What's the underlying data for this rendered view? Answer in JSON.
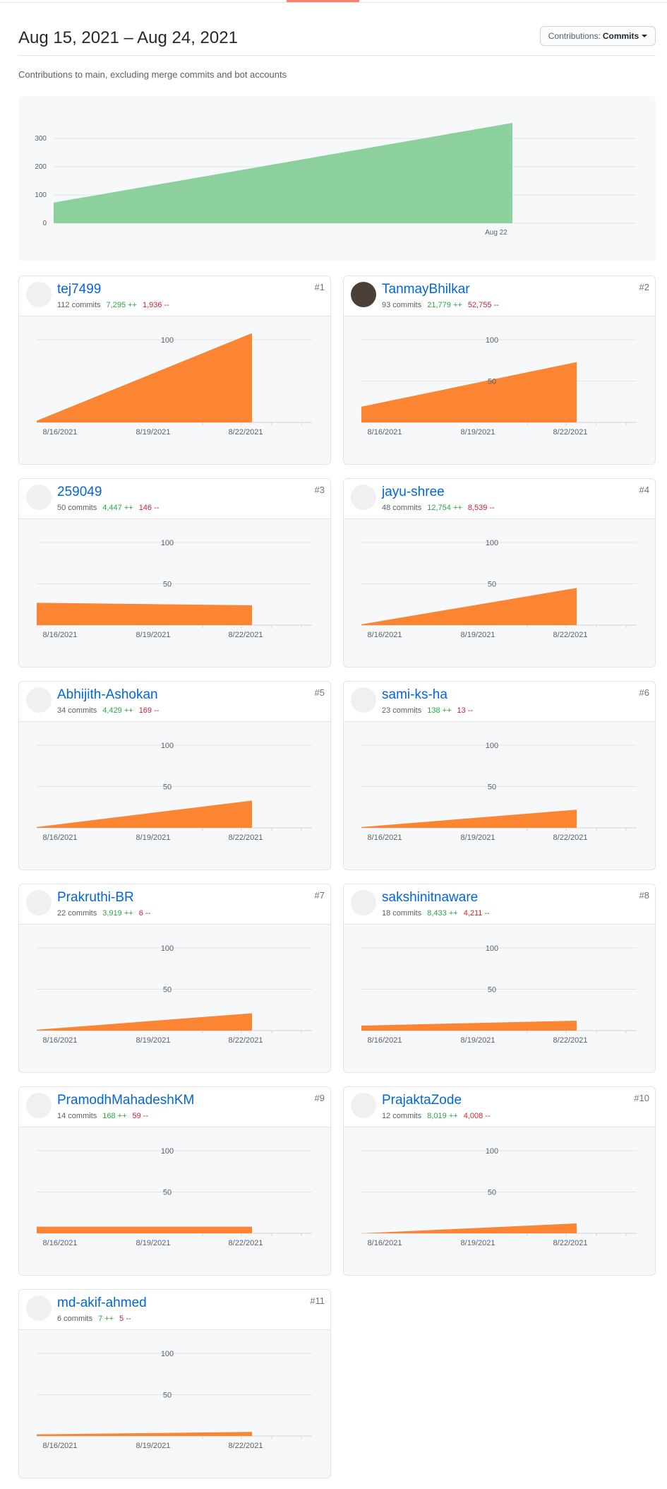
{
  "header": {
    "date_range": "Aug 15, 2021 – Aug 24, 2021",
    "select_prefix": "Contributions:",
    "select_value": "Commits",
    "subtitle": "Contributions to main, excluding merge commits and bot accounts"
  },
  "colors": {
    "total_fill": "#8cd19d",
    "contributor_fill": "#fb8532",
    "link": "#0366d6",
    "additions": "#28a745",
    "deletions": "#cb2431"
  },
  "chart_data": [
    {
      "type": "area",
      "series": [
        {
          "x": [
            "2021-08-15",
            "2021-08-24"
          ],
          "values": [
            73,
            355
          ]
        }
      ],
      "y_ticks": [
        0,
        100,
        200,
        300
      ],
      "x_ticks": [
        "Aug 22"
      ],
      "ylim": [
        0,
        380
      ],
      "grid": true
    },
    {
      "type": "area",
      "x_ticks": [
        "8/16/2021",
        "8/19/2021",
        "8/22/2021"
      ],
      "y_ticks": [
        100
      ],
      "ylim": [
        0,
        112
      ],
      "series": [
        {
          "x": [
            "8/15/2021",
            "8/22/2021"
          ],
          "values": [
            2,
            108
          ]
        }
      ]
    },
    {
      "type": "area",
      "x_ticks": [
        "8/16/2021",
        "8/19/2021",
        "8/22/2021"
      ],
      "y_ticks": [
        100,
        50
      ],
      "ylim": [
        0,
        112
      ],
      "series": [
        {
          "x": [
            "8/15/2021",
            "8/22/2021"
          ],
          "values": [
            19,
            73
          ]
        }
      ]
    },
    {
      "type": "area",
      "x_ticks": [
        "8/16/2021",
        "8/19/2021",
        "8/22/2021"
      ],
      "y_ticks": [
        100,
        50
      ],
      "ylim": [
        0,
        112
      ],
      "series": [
        {
          "x": [
            "8/15/2021",
            "8/22/2021"
          ],
          "values": [
            27,
            24
          ]
        }
      ]
    },
    {
      "type": "area",
      "x_ticks": [
        "8/16/2021",
        "8/19/2021",
        "8/22/2021"
      ],
      "y_ticks": [
        100,
        50
      ],
      "ylim": [
        0,
        112
      ],
      "series": [
        {
          "x": [
            "8/15/2021",
            "8/22/2021"
          ],
          "values": [
            1,
            45
          ]
        }
      ]
    },
    {
      "type": "area",
      "x_ticks": [
        "8/16/2021",
        "8/19/2021",
        "8/22/2021"
      ],
      "y_ticks": [
        100,
        50
      ],
      "ylim": [
        0,
        112
      ],
      "series": [
        {
          "x": [
            "8/15/2021",
            "8/22/2021"
          ],
          "values": [
            1,
            33
          ]
        }
      ]
    },
    {
      "type": "area",
      "x_ticks": [
        "8/16/2021",
        "8/19/2021",
        "8/22/2021"
      ],
      "y_ticks": [
        100,
        50
      ],
      "ylim": [
        0,
        112
      ],
      "series": [
        {
          "x": [
            "8/15/2021",
            "8/22/2021"
          ],
          "values": [
            1,
            22
          ]
        }
      ]
    },
    {
      "type": "area",
      "x_ticks": [
        "8/16/2021",
        "8/19/2021",
        "8/22/2021"
      ],
      "y_ticks": [
        100,
        50
      ],
      "ylim": [
        0,
        112
      ],
      "series": [
        {
          "x": [
            "8/15/2021",
            "8/22/2021"
          ],
          "values": [
            1,
            21
          ]
        }
      ]
    },
    {
      "type": "area",
      "x_ticks": [
        "8/16/2021",
        "8/19/2021",
        "8/22/2021"
      ],
      "y_ticks": [
        100,
        50
      ],
      "ylim": [
        0,
        112
      ],
      "series": [
        {
          "x": [
            "8/15/2021",
            "8/22/2021"
          ],
          "values": [
            6,
            12
          ]
        }
      ]
    },
    {
      "type": "area",
      "x_ticks": [
        "8/16/2021",
        "8/19/2021",
        "8/22/2021"
      ],
      "y_ticks": [
        100,
        50
      ],
      "ylim": [
        0,
        112
      ],
      "series": [
        {
          "x": [
            "8/15/2021",
            "8/22/2021"
          ],
          "values": [
            8,
            8
          ]
        }
      ]
    },
    {
      "type": "area",
      "x_ticks": [
        "8/16/2021",
        "8/19/2021",
        "8/22/2021"
      ],
      "y_ticks": [
        100,
        50
      ],
      "ylim": [
        0,
        112
      ],
      "series": [
        {
          "x": [
            "8/15/2021",
            "8/22/2021"
          ],
          "values": [
            0,
            12
          ]
        }
      ]
    },
    {
      "type": "area",
      "x_ticks": [
        "8/16/2021",
        "8/19/2021",
        "8/22/2021"
      ],
      "y_ticks": [
        100,
        50
      ],
      "ylim": [
        0,
        112
      ],
      "series": [
        {
          "x": [
            "8/15/2021",
            "8/22/2021"
          ],
          "values": [
            2,
            5
          ]
        }
      ]
    }
  ],
  "contributors": [
    {
      "name": "tej7499",
      "commits": "112 commits",
      "additions": "7,295 ++",
      "deletions": "1,936 --",
      "rank": "#1",
      "avatar_color": "#6f8fd8"
    },
    {
      "name": "TanmayBhilkar",
      "commits": "93 commits",
      "additions": "21,779 ++",
      "deletions": "52,755 --",
      "rank": "#2",
      "avatar_color": "#4a4038"
    },
    {
      "name": "259049",
      "commits": "50 commits",
      "additions": "4,447 ++",
      "deletions": "146 --",
      "rank": "#3",
      "avatar_color": "#a6cf71"
    },
    {
      "name": "jayu-shree",
      "commits": "48 commits",
      "additions": "12,754 ++",
      "deletions": "8,539 --",
      "rank": "#4",
      "avatar_color": "#b07ee0"
    },
    {
      "name": "Abhijith-Ashokan",
      "commits": "34 commits",
      "additions": "4,429 ++",
      "deletions": "169 --",
      "rank": "#5",
      "avatar_color": "#e0d070"
    },
    {
      "name": "sami-ks-ha",
      "commits": "23 commits",
      "additions": "138 ++",
      "deletions": "13 --",
      "rank": "#6",
      "avatar_color": "#d26a9a"
    },
    {
      "name": "Prakruthi-BR",
      "commits": "22 commits",
      "additions": "3,919 ++",
      "deletions": "6 --",
      "rank": "#7",
      "avatar_color": "#b9a0e6"
    },
    {
      "name": "sakshinitnaware",
      "commits": "18 commits",
      "additions": "8,433 ++",
      "deletions": "4,211 --",
      "rank": "#8",
      "avatar_color": "#d99ad8"
    },
    {
      "name": "PramodhMahadeshKM",
      "commits": "14 commits",
      "additions": "168 ++",
      "deletions": "59 --",
      "rank": "#9",
      "avatar_color": "#a6cb3a"
    },
    {
      "name": "PrajaktaZode",
      "commits": "12 commits",
      "additions": "8,019 ++",
      "deletions": "4,008 --",
      "rank": "#10",
      "avatar_color": "#9d7ad8"
    },
    {
      "name": "md-akif-ahmed",
      "commits": "6 commits",
      "additions": "7 ++",
      "deletions": "5 --",
      "rank": "#11",
      "avatar_color": "#cf5b6a"
    }
  ]
}
